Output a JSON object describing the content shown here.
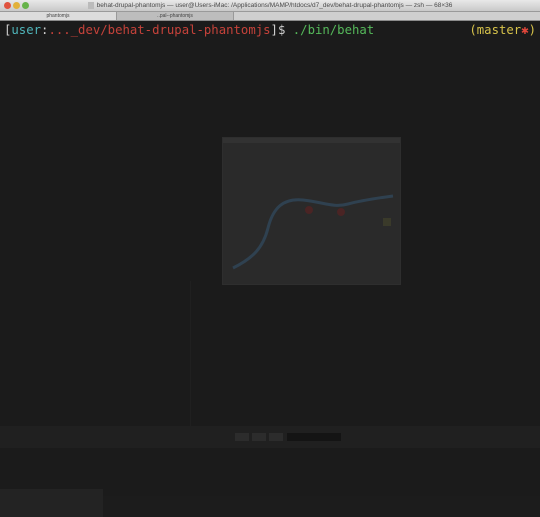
{
  "window": {
    "title": "behat-drupal-phantomjs — user@Users-iMac: /Applications/MAMP/htdocs/d7_dev/behat-drupal-phantomjs — zsh — 68×36"
  },
  "tabs": [
    {
      "label": "phantomjs"
    },
    {
      "label": "..pal--phantomjs"
    }
  ],
  "prompt": {
    "open_bracket": "[",
    "user": "user",
    "colon": ":",
    "path": "..._dev/behat-drupal-phantomjs",
    "close_bracket": "]",
    "dollar": "$",
    "command": "./bin/behat",
    "git_open": "(",
    "branch": "master",
    "dirty": "✱",
    "git_close": ")"
  },
  "colors": {
    "user": "#4fb5ba",
    "path": "#c5423a",
    "command": "#55b85a",
    "branch": "#d6c24a",
    "dirty": "#e0463a"
  }
}
